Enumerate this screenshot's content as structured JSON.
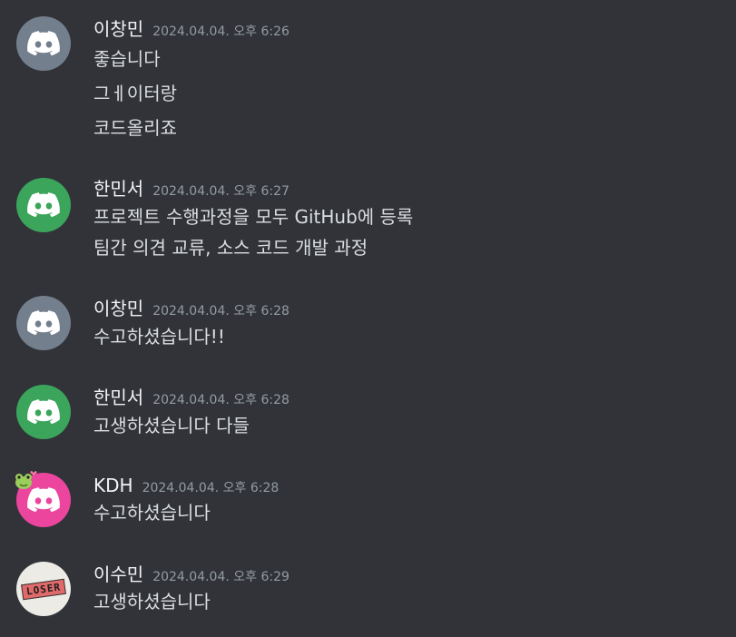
{
  "colors": {
    "background": "#313338",
    "username": "#f2f3f5",
    "timestamp": "#949ba4",
    "message_text": "#dbdee1",
    "avatar_gray": "#747f8d",
    "avatar_green": "#3ba55c",
    "avatar_pink": "#eb459e"
  },
  "messages": [
    {
      "username": "이창민",
      "timestamp": "2024.04.04. 오후 6:26",
      "avatar_icon": "discord-logo-icon",
      "avatar_color": "#747f8d",
      "lines": [
        "좋습니다",
        "그ㅔ이터랑",
        "코드올리죠"
      ]
    },
    {
      "username": "한민서",
      "timestamp": "2024.04.04. 오후 6:27",
      "avatar_icon": "discord-logo-icon",
      "avatar_color": "#3ba55c",
      "lines": [
        "프로젝트 수행과정을 모두 GitHub에 등록",
        "팀간 의견 교류, 소스 코드 개발 과정"
      ]
    },
    {
      "username": "이창민",
      "timestamp": "2024.04.04. 오후 6:28",
      "avatar_icon": "discord-logo-icon",
      "avatar_color": "#747f8d",
      "lines": [
        "수고하셨습니다!!"
      ]
    },
    {
      "username": "한민서",
      "timestamp": "2024.04.04. 오후 6:28",
      "avatar_icon": "discord-logo-icon",
      "avatar_color": "#3ba55c",
      "lines": [
        "고생하셨습니다 다들"
      ]
    },
    {
      "username": "KDH",
      "timestamp": "2024.04.04. 오후 6:28",
      "avatar_icon": "discord-logo-icon",
      "avatar_color": "#eb459e",
      "avatar_decoration": "frog-decoration-icon",
      "lines": [
        "수고하셨습니다"
      ]
    },
    {
      "username": "이수민",
      "timestamp": "2024.04.04. 오후 6:29",
      "avatar_image_text": "LOSER",
      "lines": [
        "고생하셨습니다"
      ]
    }
  ]
}
